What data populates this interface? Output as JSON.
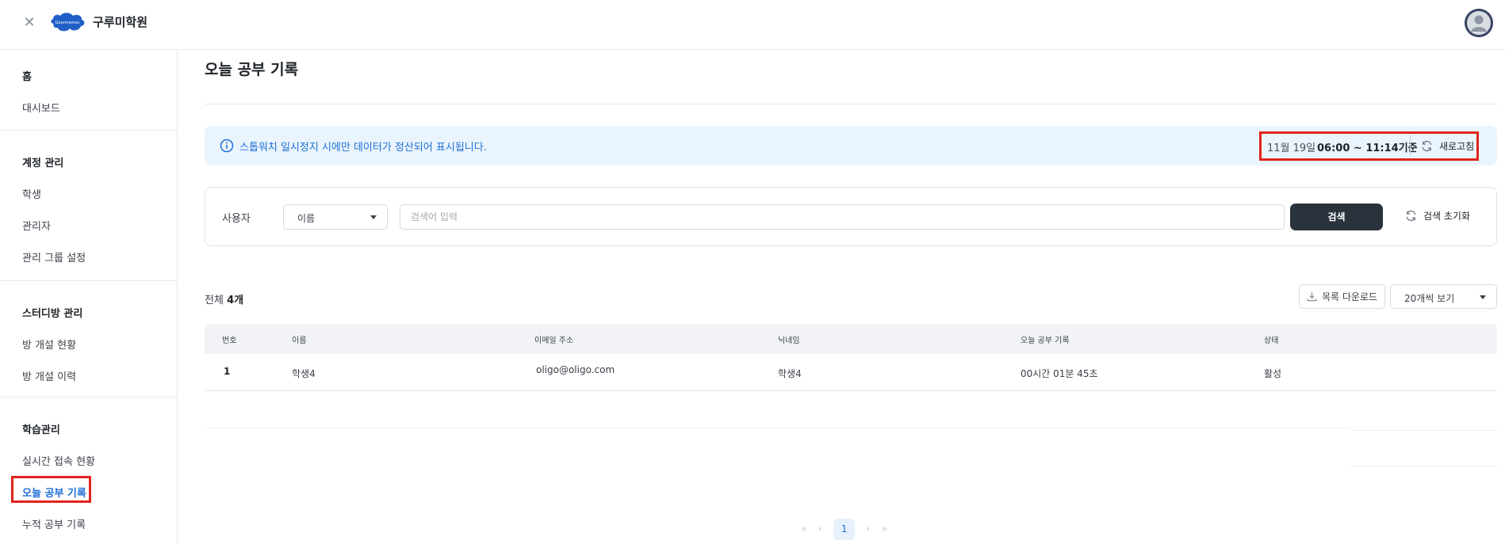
{
  "header": {
    "close_icon": "close-icon",
    "logo_text": "Goormomex",
    "academy_name": "구루미학원",
    "avatar_icon": "user-avatar"
  },
  "sidebar": {
    "home": {
      "heading": "홈",
      "items": [
        "대시보드"
      ]
    },
    "account": {
      "heading": "계정 관리",
      "items": [
        "학생",
        "관리자",
        "관리 그룹 설정"
      ]
    },
    "studyroom": {
      "heading": "스터디방 관리",
      "items": [
        "방 개설 현황",
        "방 개설 이력"
      ]
    },
    "learning": {
      "heading": "학습관리",
      "items": [
        "실시간 접속 현황",
        "오늘 공부 기록",
        "누적 공부 기록"
      ],
      "active_index": 1
    }
  },
  "page": {
    "title": "오늘 공부 기록"
  },
  "notice": {
    "text": "스톱워치 일시정지 시에만 데이터가 정산되어 표시됩니다.",
    "date": "11월 19일",
    "time_range": "06:00 ~ 11:14기준",
    "refresh_label": "새로고침"
  },
  "search": {
    "label": "사용자",
    "field_select": "이름",
    "input_value": "",
    "placeholder": "검색어 입력",
    "search_button": "검색",
    "reset_button": "검색 초기화"
  },
  "list": {
    "total_prefix": "전체",
    "total_count": "4개",
    "download_label": "목록 다운로드",
    "per_page": "20개씩 보기"
  },
  "table": {
    "headers": [
      "번호",
      "이름",
      "이메일 주소",
      "닉네임",
      "오늘 공부 기록",
      "상태"
    ],
    "rows": [
      [
        "1",
        "학생4",
        "oligo@oligo.com",
        "학생4",
        "00시간 01분 45초",
        "활성"
      ]
    ]
  },
  "pagination": {
    "current": "1",
    "first": "«",
    "prev": "‹",
    "next": "›",
    "last": "»"
  },
  "colors": {
    "accent": "#1f6fd6",
    "highlight": "#e0231d",
    "notice_bg": "#eaf4fd",
    "search_btn": "#2a323c"
  }
}
